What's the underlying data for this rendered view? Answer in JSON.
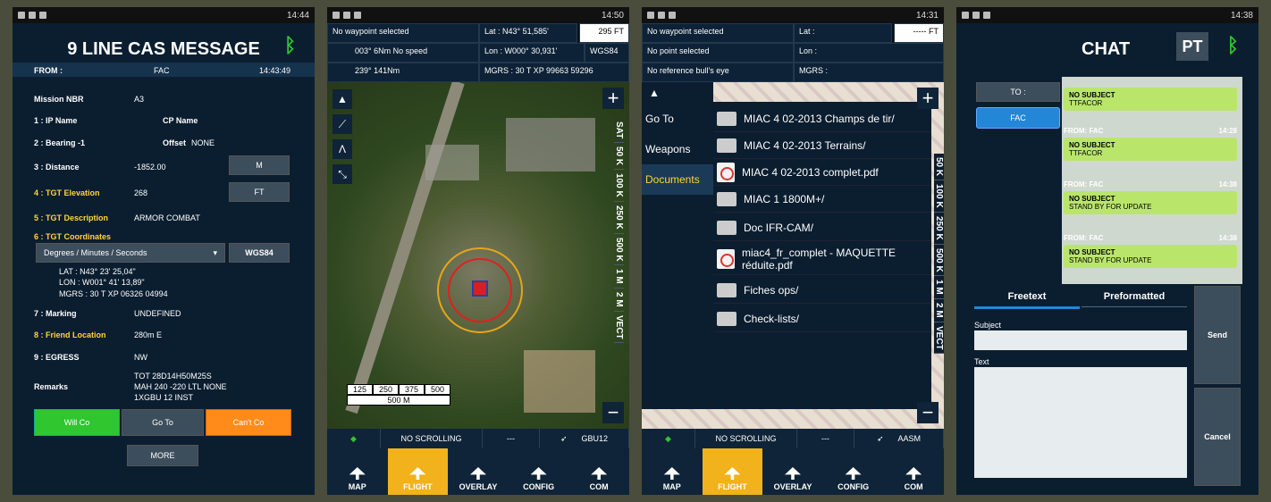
{
  "cas": {
    "status_time": "14:44",
    "title": "9 LINE CAS MESSAGE",
    "from_label": "FROM :",
    "from_value": "FAC",
    "from_time": "14:43:49",
    "mission_label": "Mission NBR",
    "mission_value": "A3",
    "ip_label": "1 : IP Name",
    "cp_label": "CP Name",
    "bearing_label": "2 : Bearing  -1",
    "offset_label": "Offset",
    "offset_value": "NONE",
    "distance_label": "3 : Distance",
    "distance_value": "-1852.00",
    "m_btn": "M",
    "elev_label": "4 : TGT Elevation",
    "elev_value": "268",
    "ft_btn": "FT",
    "desc_label": "5 : TGT Description",
    "desc_value": "ARMOR COMBAT",
    "coord_label": "6 : TGT Coordinates",
    "coord_select": "Degrees / Minutes / Seconds",
    "wgs_btn": "WGS84",
    "lat": "LAT : N43° 23' 25,04\"",
    "lon": "LON : W001° 41' 13,89\"",
    "mgrs": "MGRS : 30 T XP 06326 04994",
    "marking_label": "7 : Marking",
    "marking_value": "UNDEFINED",
    "friend_label": "8 : Friend Location",
    "friend_value": "280m E",
    "egress_label": "9 : EGRESS",
    "egress_value": "NW",
    "remarks_label": "Remarks",
    "remarks_1": "TOT 28D14H50M25S",
    "remarks_2": "MAH 240 -220 LTL NONE",
    "remarks_3": "1XGBU 12 INST",
    "willco": "Will Co",
    "goto": "Go To",
    "cantco": "Can't Co",
    "more": "MORE"
  },
  "map1": {
    "status_time": "14:50",
    "waypoint": "No waypoint selected",
    "speed_a": "003°  6Nm  No speed",
    "speed_b": "239°  141Nm",
    "lat": "Lat : N43° 51,585'",
    "alt": "295 FT",
    "lon": "Lon : W000° 30,931'",
    "datum": "WGS84",
    "mgrs": "MGRS : 30 T XP 99663 59296",
    "scale_ticks": [
      "125",
      "250",
      "375",
      "500"
    ],
    "scale_label": "500 M",
    "scales": [
      "SAT",
      "50 K",
      "100 K",
      "250 K",
      "500 K",
      "1 M",
      "2 M",
      "VECT"
    ],
    "scrolling": "NO SCROLLING",
    "dashes": "---",
    "weapon": "GBU12"
  },
  "map2": {
    "status_time": "14:31",
    "waypoint": "No waypoint selected",
    "point": "No point selected",
    "bulls": "No reference bull's eye",
    "lat": "Lat :",
    "lon": "Lon :",
    "mgrs": "MGRS :",
    "alt": "----- FT",
    "menu": [
      "Go To",
      "Weapons",
      "Documents"
    ],
    "docs": [
      "MIAC 4 02-2013 Champs de tir/",
      "MIAC 4 02-2013 Terrains/",
      "MIAC 4 02-2013 complet.pdf",
      "MIAC 1 1800M+/",
      "Doc IFR-CAM/",
      "miac4_fr_complet - MAQUETTE réduite.pdf",
      "Fiches ops/",
      "Check-lists/"
    ],
    "scales": [
      "50 K",
      "100 K",
      "250 K",
      "500 K",
      "1 M",
      "2 M",
      "VECT"
    ],
    "scrolling": "NO SCROLLING",
    "dashes": "---",
    "weapon": "AASM"
  },
  "nav": [
    "MAP",
    "FLIGHT",
    "OVERLAY",
    "CONFIG",
    "COM"
  ],
  "chat": {
    "status_time": "14:38",
    "title": "CHAT",
    "badge": "PT",
    "to_label": "TO :",
    "fac_btn": "FAC",
    "subject0": "NO SUBJECT",
    "body0": "TTFACOR",
    "messages": [
      {
        "from": "FROM: FAC",
        "time": "14:28",
        "subject": "NO SUBJECT",
        "body": "TTFACOR"
      },
      {
        "from": "FROM: FAC",
        "time": "14:38",
        "subject": "NO SUBJECT",
        "body": "STAND BY FOR UPDATE"
      },
      {
        "from": "FROM: FAC",
        "time": "14:38",
        "subject": "NO SUBJECT",
        "body": "STAND BY FOR UPDATE"
      }
    ],
    "tab_free": "Freetext",
    "tab_pre": "Preformatted",
    "subject_label": "Subject",
    "text_label": "Text",
    "send": "Send",
    "cancel": "Cancel"
  },
  "colors": {
    "accent": "#f2b21b",
    "green": "#2fc62f",
    "orange": "#ff8c1a",
    "panel": "#0f2438"
  }
}
